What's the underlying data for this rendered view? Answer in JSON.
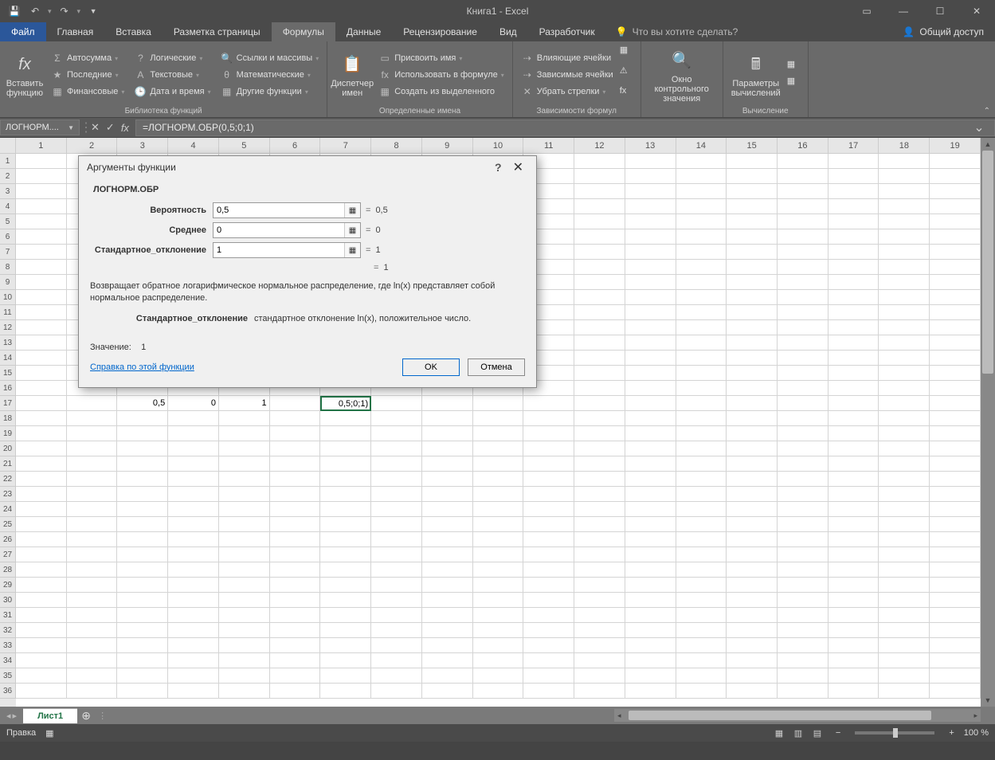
{
  "title": "Книга1 - Excel",
  "qat": {
    "save": "💾",
    "undo": "↶",
    "redo": "↷"
  },
  "tabs": {
    "file": "Файл",
    "items": [
      "Главная",
      "Вставка",
      "Разметка страницы",
      "Формулы",
      "Данные",
      "Рецензирование",
      "Вид",
      "Разработчик"
    ],
    "active_index": 3,
    "tell_me": "Что вы хотите сделать?",
    "share": "Общий доступ"
  },
  "ribbon": {
    "insert_func": {
      "label": "Вставить\nфункцию"
    },
    "lib": {
      "autosum": "Автосумма",
      "recent": "Последние",
      "financial": "Финансовые",
      "logical": "Логические",
      "text": "Текстовые",
      "datetime": "Дата и время",
      "lookup": "Ссылки и массивы",
      "math": "Математические",
      "more": "Другие функции",
      "group_label": "Библиотека функций"
    },
    "names": {
      "manager": "Диспетчер\nимен",
      "assign": "Присвоить имя",
      "use": "Использовать в формуле",
      "create": "Создать из выделенного",
      "group_label": "Определенные имена"
    },
    "audit": {
      "precedents": "Влияющие ячейки",
      "dependents": "Зависимые ячейки",
      "remove_arrows": "Убрать стрелки",
      "group_label": "Зависимости формул"
    },
    "watch": "Окно контрольного\nзначения",
    "calc": {
      "options": "Параметры\nвычислений",
      "group_label": "Вычисление"
    }
  },
  "namebox": "ЛОГНОРМ....",
  "formula": "=ЛОГНОРМ.ОБР(0,5;0;1)",
  "columns": [
    "1",
    "2",
    "3",
    "4",
    "5",
    "6",
    "7",
    "8",
    "9",
    "10",
    "11",
    "12",
    "13",
    "14",
    "15",
    "16",
    "17",
    "18",
    "19"
  ],
  "row_start": 1,
  "row_end": 36,
  "cells": {
    "r17": {
      "c3": "0,5",
      "c4": "0",
      "c5": "1",
      "c7_display": "0,5;0;1)"
    }
  },
  "dialog": {
    "title": "Аргументы функции",
    "func_name": "ЛОГНОРМ.ОБР",
    "args": [
      {
        "label": "Вероятность",
        "value": "0,5",
        "result": "0,5"
      },
      {
        "label": "Среднее",
        "value": "0",
        "result": "0"
      },
      {
        "label": "Стандартное_отклонение",
        "value": "1",
        "result": "1"
      }
    ],
    "overall_eq": "= ",
    "overall_result": "1",
    "description": "Возвращает обратное логарифмическое нормальное распределение, где ln(x) представляет собой нормальное распределение.",
    "arg_desc_label": "Стандартное_отклонение",
    "arg_desc_text": "стандартное отклонение ln(x), положительное число.",
    "value_label": "Значение:",
    "value_result": "1",
    "help_link": "Справка по этой функции",
    "ok": "OK",
    "cancel": "Отмена"
  },
  "sheet_tab": "Лист1",
  "status": {
    "mode": "Правка",
    "zoom": "100 %"
  }
}
